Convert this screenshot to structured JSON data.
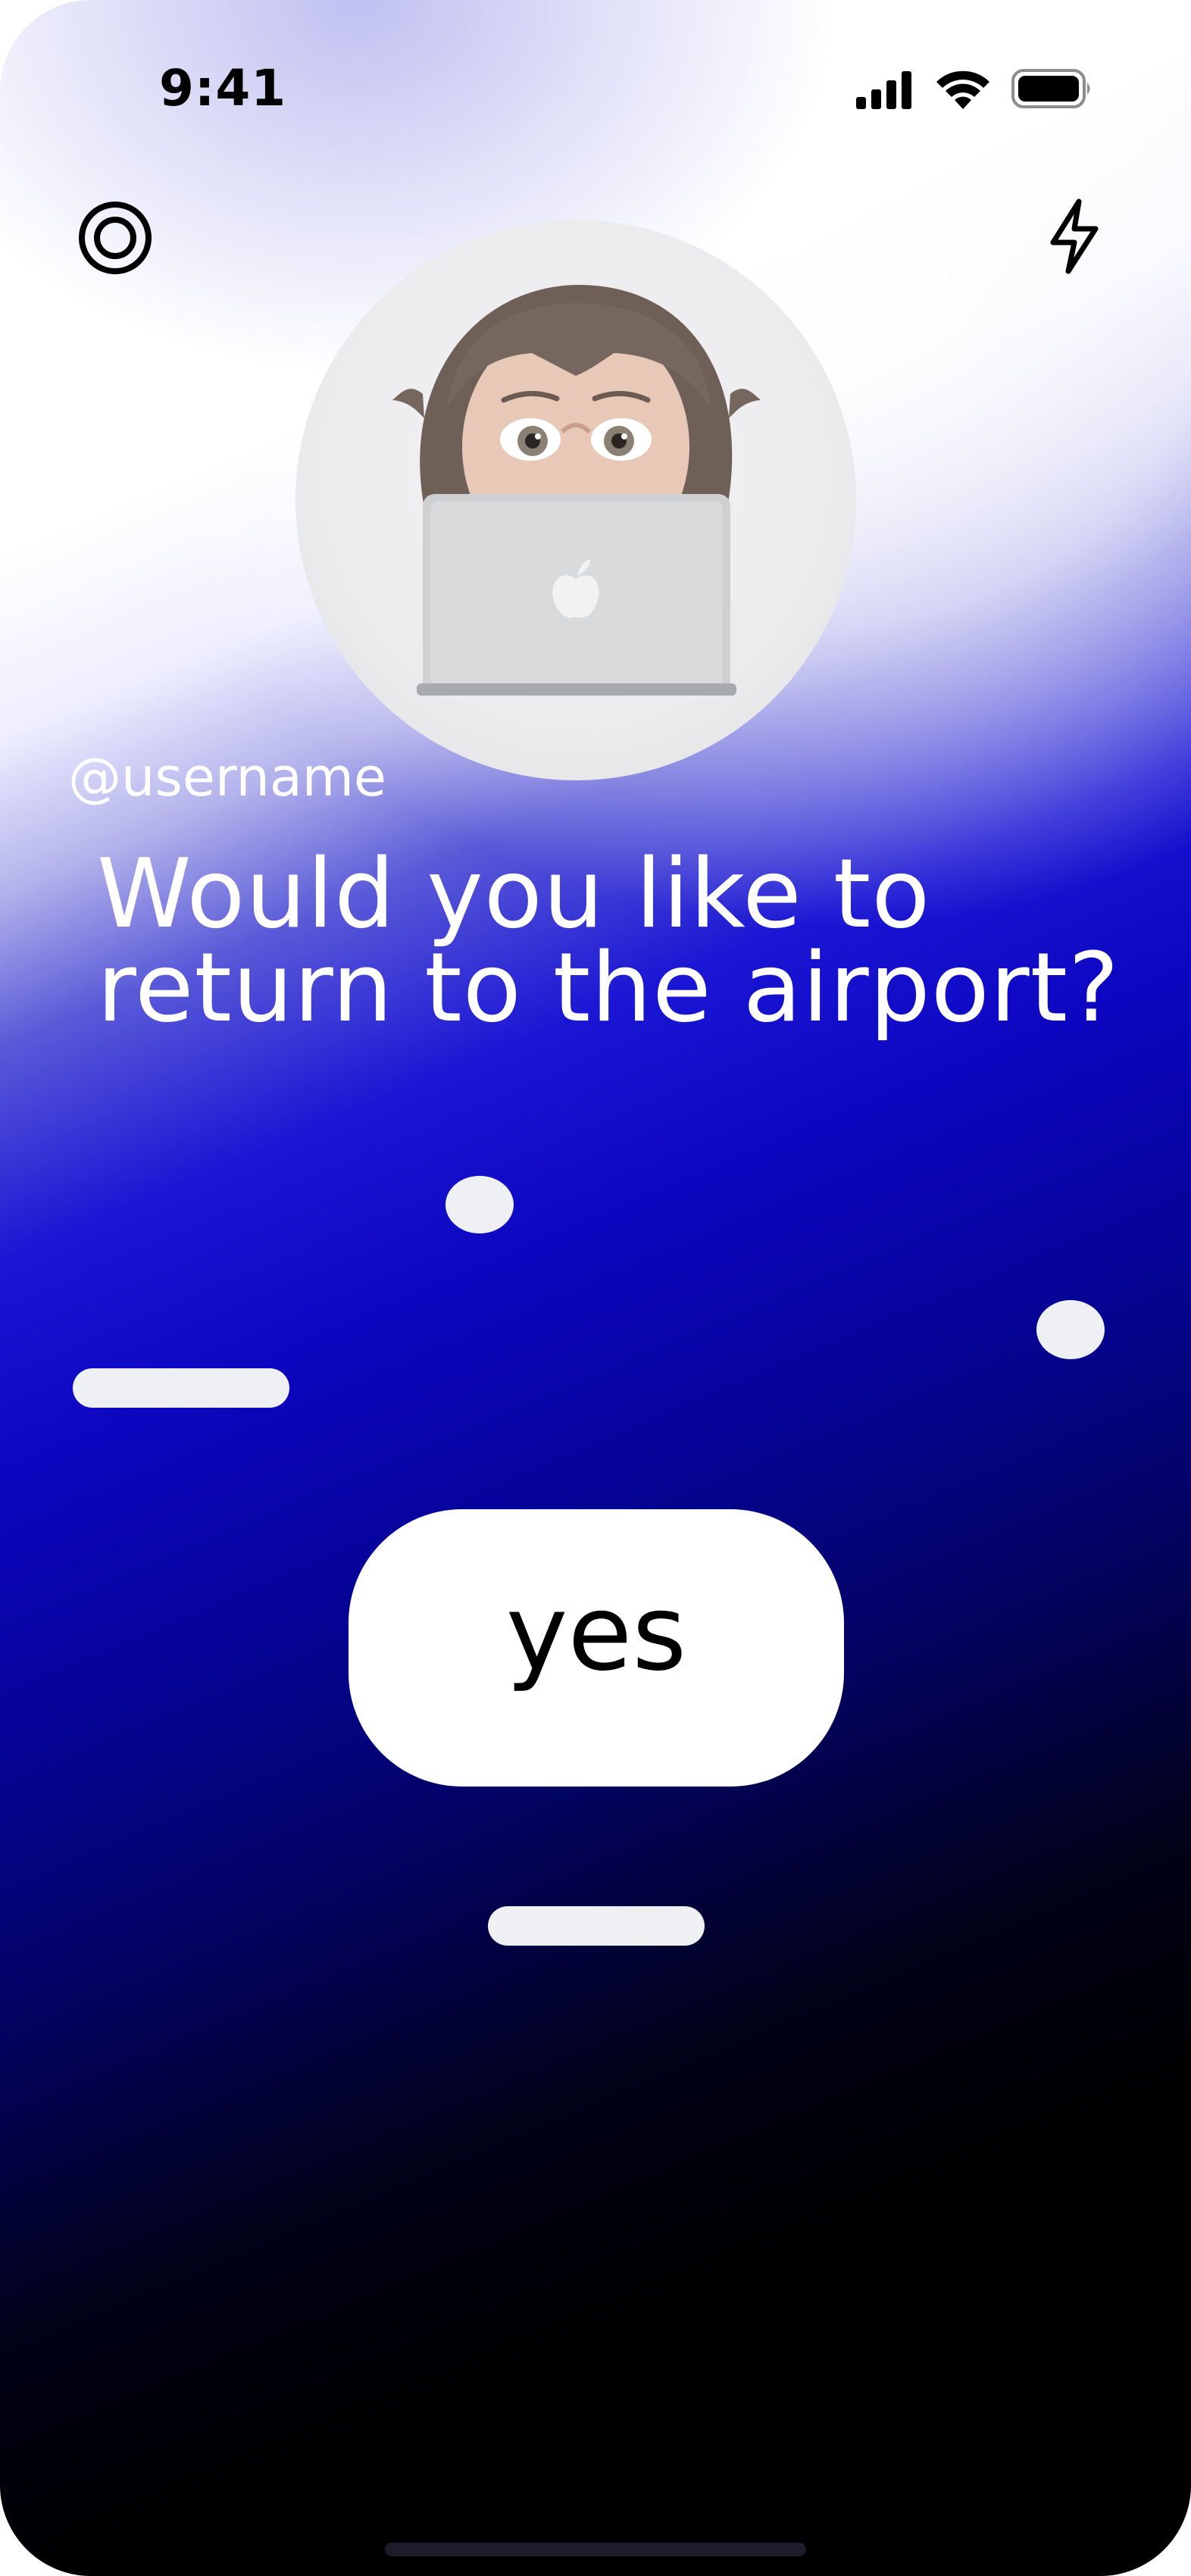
{
  "status_bar": {
    "time": "9:41",
    "icons": [
      "signal-icon",
      "wifi-icon",
      "battery-icon"
    ]
  },
  "top_bar": {
    "left_icon": "target-icon",
    "right_icon": "bolt-icon"
  },
  "profile": {
    "avatar": "memoji-avatar-with-laptop",
    "username": "@username"
  },
  "prompt": {
    "question": "Would you like to return to the airport?"
  },
  "actions": {
    "yes_label": "yes"
  },
  "colors": {
    "background_top": "#ffffff",
    "background_mid": "#0c06c0",
    "background_bottom": "#000000",
    "button_bg": "#ffffff",
    "pill": "#eef0f3"
  }
}
